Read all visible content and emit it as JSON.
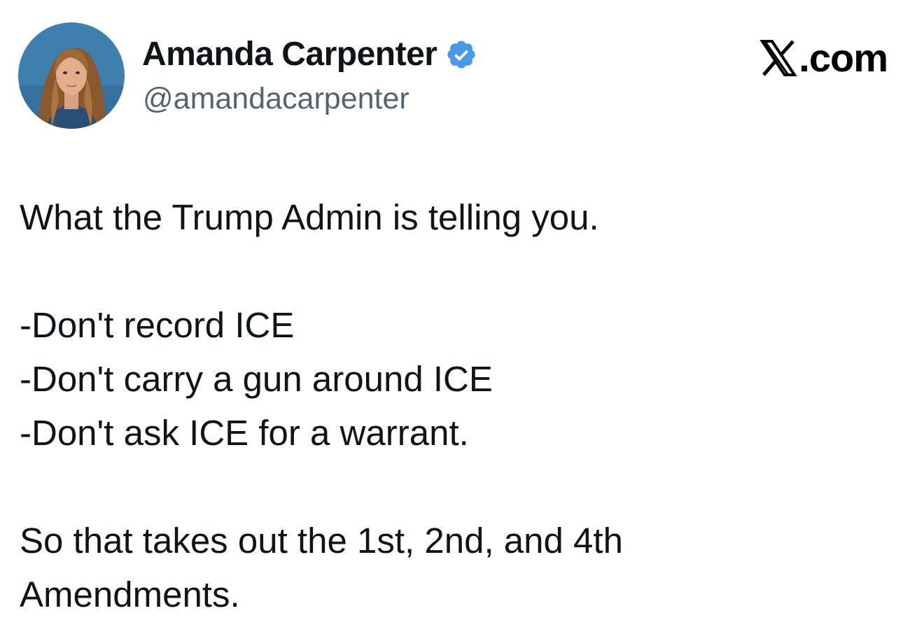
{
  "author": {
    "name": "Amanda Carpenter",
    "handle": "@amandacarpenter",
    "verified": true,
    "verified_color": "#4a99e9"
  },
  "brand": {
    "text": ".com",
    "logo_icon": "x-logo-icon"
  },
  "tweet": {
    "intro": "What the Trump Admin is telling you.",
    "items": [
      "-Don't record ICE",
      "-Don't carry a gun around ICE",
      "-Don't ask ICE for a warrant."
    ],
    "conclusion_line1": "So that takes out the 1st, 2nd, and 4th",
    "conclusion_line2": "Amendments."
  }
}
